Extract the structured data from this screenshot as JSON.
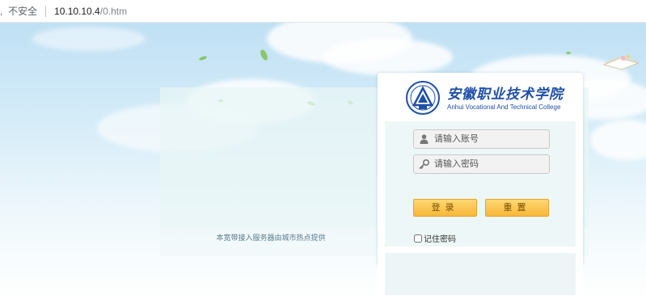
{
  "browser": {
    "lead_char": ",",
    "security_label": "不安全",
    "host": "10.10.10.4",
    "path": "/0.htm"
  },
  "header": {
    "school_name_cn": "安徽职业技术学院",
    "school_name_en": "Anhui Vocational And Technical College"
  },
  "login": {
    "username_placeholder": "请输入账号",
    "password_placeholder": "请输入密码",
    "login_button": "登录",
    "reset_button": "重置",
    "remember_label": "记住密码"
  },
  "footer": {
    "text": "本宽带接入服务器由城市热点提供"
  },
  "colors": {
    "brand": "#1f4fa6",
    "button": "#f6b73a"
  },
  "icons": {
    "user": "user-icon",
    "key": "key-icon"
  }
}
